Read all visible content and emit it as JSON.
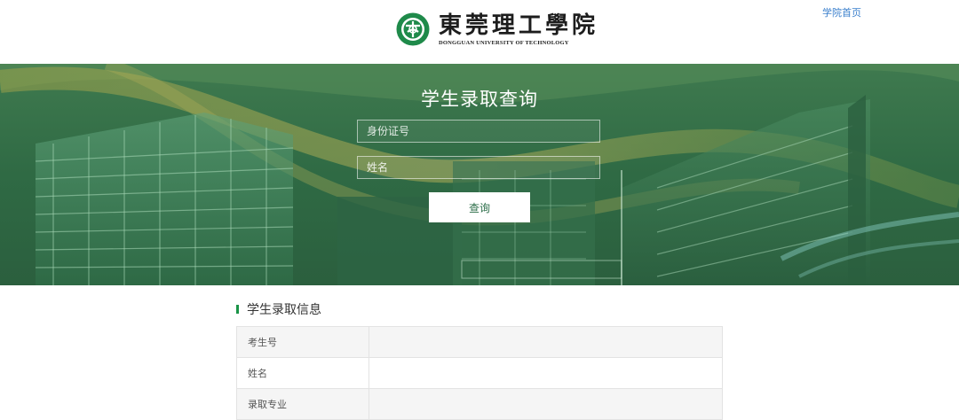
{
  "header": {
    "logo_cn": "東莞理工學院",
    "logo_en": "DONGGUAN UNIVERSITY OF TECHNOLOGY",
    "home_link": "学院首页"
  },
  "query": {
    "title": "学生录取查询",
    "id_placeholder": "身份证号",
    "name_placeholder": "姓名",
    "submit_label": "查询"
  },
  "info": {
    "title": "学生录取信息",
    "rows": [
      {
        "label": "考生号",
        "value": ""
      },
      {
        "label": "姓名",
        "value": ""
      },
      {
        "label": "录取专业",
        "value": ""
      }
    ]
  },
  "colors": {
    "brand_green": "#2c6e49",
    "accent_green": "#1a9447",
    "link_blue": "#3a7fcc"
  }
}
